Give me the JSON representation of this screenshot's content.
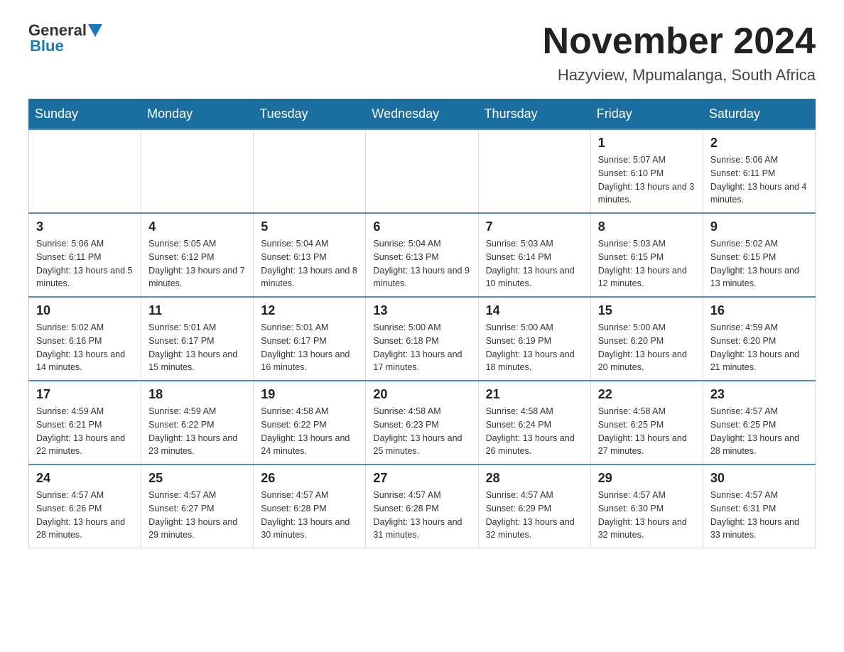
{
  "header": {
    "logo": {
      "general": "General",
      "blue": "Blue"
    },
    "month": "November 2024",
    "location": "Hazyview, Mpumalanga, South Africa"
  },
  "calendar": {
    "weekdays": [
      "Sunday",
      "Monday",
      "Tuesday",
      "Wednesday",
      "Thursday",
      "Friday",
      "Saturday"
    ],
    "weeks": [
      [
        {
          "day": "",
          "info": ""
        },
        {
          "day": "",
          "info": ""
        },
        {
          "day": "",
          "info": ""
        },
        {
          "day": "",
          "info": ""
        },
        {
          "day": "",
          "info": ""
        },
        {
          "day": "1",
          "info": "Sunrise: 5:07 AM\nSunset: 6:10 PM\nDaylight: 13 hours and 3 minutes."
        },
        {
          "day": "2",
          "info": "Sunrise: 5:06 AM\nSunset: 6:11 PM\nDaylight: 13 hours and 4 minutes."
        }
      ],
      [
        {
          "day": "3",
          "info": "Sunrise: 5:06 AM\nSunset: 6:11 PM\nDaylight: 13 hours and 5 minutes."
        },
        {
          "day": "4",
          "info": "Sunrise: 5:05 AM\nSunset: 6:12 PM\nDaylight: 13 hours and 7 minutes."
        },
        {
          "day": "5",
          "info": "Sunrise: 5:04 AM\nSunset: 6:13 PM\nDaylight: 13 hours and 8 minutes."
        },
        {
          "day": "6",
          "info": "Sunrise: 5:04 AM\nSunset: 6:13 PM\nDaylight: 13 hours and 9 minutes."
        },
        {
          "day": "7",
          "info": "Sunrise: 5:03 AM\nSunset: 6:14 PM\nDaylight: 13 hours and 10 minutes."
        },
        {
          "day": "8",
          "info": "Sunrise: 5:03 AM\nSunset: 6:15 PM\nDaylight: 13 hours and 12 minutes."
        },
        {
          "day": "9",
          "info": "Sunrise: 5:02 AM\nSunset: 6:15 PM\nDaylight: 13 hours and 13 minutes."
        }
      ],
      [
        {
          "day": "10",
          "info": "Sunrise: 5:02 AM\nSunset: 6:16 PM\nDaylight: 13 hours and 14 minutes."
        },
        {
          "day": "11",
          "info": "Sunrise: 5:01 AM\nSunset: 6:17 PM\nDaylight: 13 hours and 15 minutes."
        },
        {
          "day": "12",
          "info": "Sunrise: 5:01 AM\nSunset: 6:17 PM\nDaylight: 13 hours and 16 minutes."
        },
        {
          "day": "13",
          "info": "Sunrise: 5:00 AM\nSunset: 6:18 PM\nDaylight: 13 hours and 17 minutes."
        },
        {
          "day": "14",
          "info": "Sunrise: 5:00 AM\nSunset: 6:19 PM\nDaylight: 13 hours and 18 minutes."
        },
        {
          "day": "15",
          "info": "Sunrise: 5:00 AM\nSunset: 6:20 PM\nDaylight: 13 hours and 20 minutes."
        },
        {
          "day": "16",
          "info": "Sunrise: 4:59 AM\nSunset: 6:20 PM\nDaylight: 13 hours and 21 minutes."
        }
      ],
      [
        {
          "day": "17",
          "info": "Sunrise: 4:59 AM\nSunset: 6:21 PM\nDaylight: 13 hours and 22 minutes."
        },
        {
          "day": "18",
          "info": "Sunrise: 4:59 AM\nSunset: 6:22 PM\nDaylight: 13 hours and 23 minutes."
        },
        {
          "day": "19",
          "info": "Sunrise: 4:58 AM\nSunset: 6:22 PM\nDaylight: 13 hours and 24 minutes."
        },
        {
          "day": "20",
          "info": "Sunrise: 4:58 AM\nSunset: 6:23 PM\nDaylight: 13 hours and 25 minutes."
        },
        {
          "day": "21",
          "info": "Sunrise: 4:58 AM\nSunset: 6:24 PM\nDaylight: 13 hours and 26 minutes."
        },
        {
          "day": "22",
          "info": "Sunrise: 4:58 AM\nSunset: 6:25 PM\nDaylight: 13 hours and 27 minutes."
        },
        {
          "day": "23",
          "info": "Sunrise: 4:57 AM\nSunset: 6:25 PM\nDaylight: 13 hours and 28 minutes."
        }
      ],
      [
        {
          "day": "24",
          "info": "Sunrise: 4:57 AM\nSunset: 6:26 PM\nDaylight: 13 hours and 28 minutes."
        },
        {
          "day": "25",
          "info": "Sunrise: 4:57 AM\nSunset: 6:27 PM\nDaylight: 13 hours and 29 minutes."
        },
        {
          "day": "26",
          "info": "Sunrise: 4:57 AM\nSunset: 6:28 PM\nDaylight: 13 hours and 30 minutes."
        },
        {
          "day": "27",
          "info": "Sunrise: 4:57 AM\nSunset: 6:28 PM\nDaylight: 13 hours and 31 minutes."
        },
        {
          "day": "28",
          "info": "Sunrise: 4:57 AM\nSunset: 6:29 PM\nDaylight: 13 hours and 32 minutes."
        },
        {
          "day": "29",
          "info": "Sunrise: 4:57 AM\nSunset: 6:30 PM\nDaylight: 13 hours and 32 minutes."
        },
        {
          "day": "30",
          "info": "Sunrise: 4:57 AM\nSunset: 6:31 PM\nDaylight: 13 hours and 33 minutes."
        }
      ]
    ]
  }
}
